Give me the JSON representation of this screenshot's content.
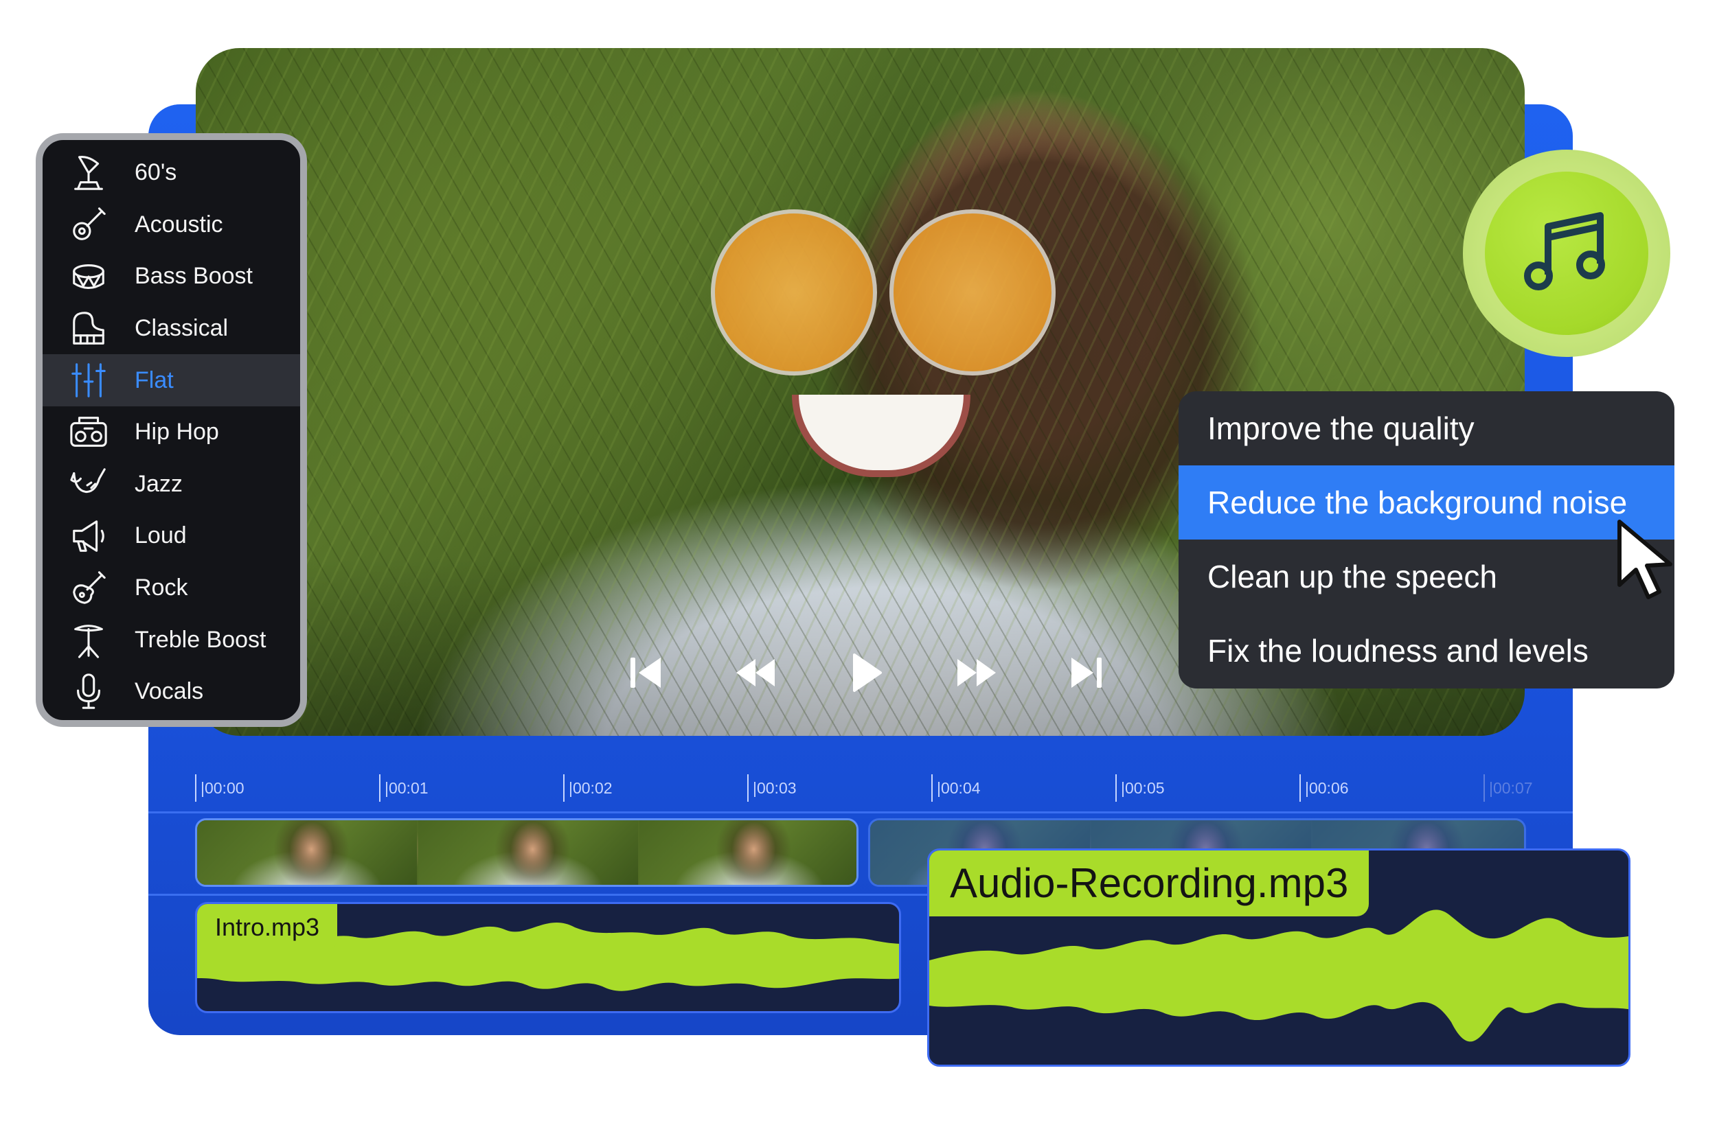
{
  "eq_presets": {
    "items": [
      {
        "label": "60's",
        "icon": "gramophone-icon"
      },
      {
        "label": "Acoustic",
        "icon": "acoustic-guitar-icon"
      },
      {
        "label": "Bass Boost",
        "icon": "drum-icon"
      },
      {
        "label": "Classical",
        "icon": "piano-icon"
      },
      {
        "label": "Flat",
        "icon": "equalizer-sliders-icon"
      },
      {
        "label": "Hip Hop",
        "icon": "boombox-icon"
      },
      {
        "label": "Jazz",
        "icon": "saxophone-icon"
      },
      {
        "label": "Loud",
        "icon": "megaphone-icon"
      },
      {
        "label": "Rock",
        "icon": "electric-guitar-icon"
      },
      {
        "label": "Treble Boost",
        "icon": "cymbal-icon"
      },
      {
        "label": "Vocals",
        "icon": "microphone-icon"
      }
    ],
    "selected": "Flat"
  },
  "ai_menu": {
    "items": [
      "Improve the quality",
      "Reduce the background noise",
      "Clean up the speech",
      "Fix the loudness and levels"
    ],
    "highlighted": "Reduce the background noise"
  },
  "player": {
    "controls": [
      "skip-back-icon",
      "rewind-icon",
      "play-icon",
      "fast-forward-icon",
      "skip-forward-icon"
    ]
  },
  "badge": {
    "icon": "music-note-icon"
  },
  "timeline": {
    "ticks": [
      "|00:00",
      "|00:01",
      "|00:02",
      "|00:03",
      "|00:04",
      "|00:05",
      "|00:06",
      "|00:07"
    ],
    "clips": {
      "intro_audio": "Intro.mp3",
      "main_audio": "Audio-Recording.mp3"
    }
  },
  "colors": {
    "frame_blue": "#1f62f0",
    "accent_blue": "#2f7df5",
    "waveform_green": "#a9dc2a",
    "menu_dark": "#2b2d33",
    "eq_menu_dark": "#131418"
  }
}
